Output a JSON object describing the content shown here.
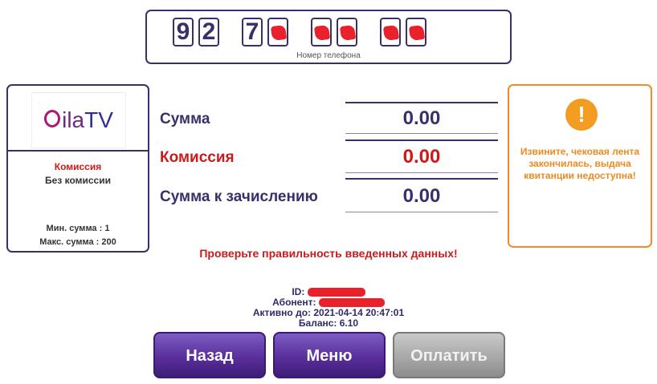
{
  "phone": {
    "digits": [
      "9",
      "2",
      "7",
      "",
      "",
      "",
      "",
      "",
      ""
    ],
    "label": "Номер телефона"
  },
  "provider": {
    "logo_text_a": "ila",
    "logo_text_b": "TV",
    "commission_title": "Комиссия",
    "commission_value": "Без комиссии",
    "min_sum": "Мин. сумма : 1",
    "max_sum": "Макс. сумма : 200"
  },
  "summary": {
    "sum_label": "Сумма",
    "sum_value": "0.00",
    "commission_label": "Комиссия",
    "commission_value": "0.00",
    "credit_label": "Сумма к зачислению",
    "credit_value": "0.00"
  },
  "notice": {
    "icon": "!",
    "text": "Извините, чековая лента закончилась, выдача квитанции недоступна!"
  },
  "check_message": "Проверьте правильность введенных данных!",
  "info": {
    "id_label": "ID:",
    "subscriber_label": "Абонент:",
    "active_until": "Активно до: 2021-04-14 20:47:01",
    "balance": "Баланс: 6.10"
  },
  "buttons": {
    "back": "Назад",
    "menu": "Меню",
    "pay": "Оплатить"
  },
  "colors": {
    "accent_purple": "#3b2f66",
    "alert_red": "#c81b1b",
    "warning_orange": "#f39c22"
  }
}
